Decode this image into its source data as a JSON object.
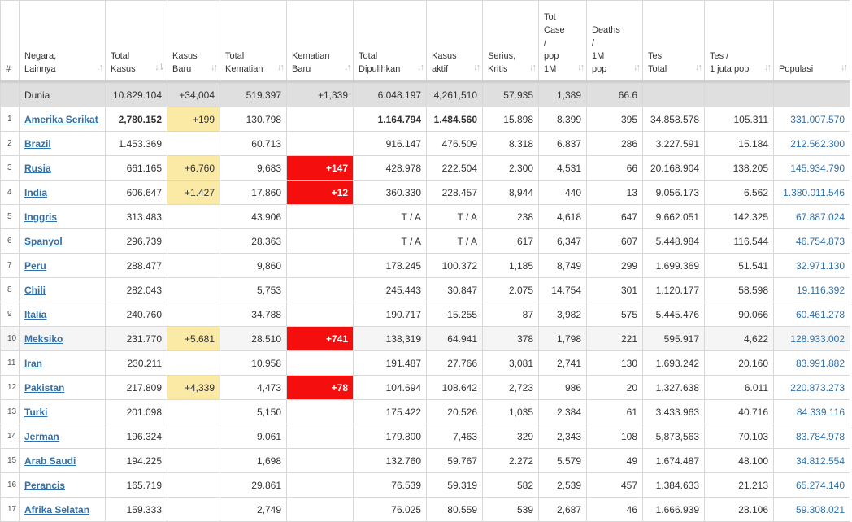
{
  "columns": [
    {
      "label": "#"
    },
    {
      "label": "Negara,\nLainnya"
    },
    {
      "label": "Total\nKasus"
    },
    {
      "label": "Kasus\nBaru"
    },
    {
      "label": "Total\nKematian"
    },
    {
      "label": "Kematian\nBaru"
    },
    {
      "label": "Total\nDipulihkan"
    },
    {
      "label": "Kasus\naktif"
    },
    {
      "label": "Serius,\nKritis"
    },
    {
      "label": "Tot\nCase\n/\npop\n1M"
    },
    {
      "label": "Deaths\n/\n1M\npop"
    },
    {
      "label": "Tes\nTotal"
    },
    {
      "label": "Tes /\n1 juta pop"
    },
    {
      "label": "Populasi"
    }
  ],
  "sort_icon": "sort-arrows-icon",
  "world": {
    "country": "Dunia",
    "total_cases": "10.829.104",
    "new_cases": "+34,004",
    "total_deaths": "519.397",
    "new_deaths": "+1,339",
    "recovered": "6.048.197",
    "active": "4,261,510",
    "serious": "57.935",
    "cases_per_1m": "1,389",
    "deaths_per_1m": "66.6",
    "tests": "",
    "tests_per_1m": "",
    "population": ""
  },
  "rows": [
    {
      "rank": "1",
      "country": "Amerika Serikat",
      "total_cases": "2,780.152",
      "new_cases": "+199",
      "total_deaths": "130.798",
      "new_deaths": "",
      "recovered": "1.164.794",
      "active": "1.484.560",
      "serious": "15.898",
      "cases_per_1m": "8.399",
      "deaths_per_1m": "395",
      "tests": "34.858.578",
      "tests_per_1m": "105.311",
      "population": "331.007.570"
    },
    {
      "rank": "2",
      "country": "Brazil",
      "total_cases": "1.453.369",
      "new_cases": "",
      "total_deaths": "60.713",
      "new_deaths": "",
      "recovered": "916.147",
      "active": "476.509",
      "serious": "8.318",
      "cases_per_1m": "6.837",
      "deaths_per_1m": "286",
      "tests": "3.227.591",
      "tests_per_1m": "15.184",
      "population": "212.562.300"
    },
    {
      "rank": "3",
      "country": "Rusia",
      "total_cases": "661.165",
      "new_cases": "+6.760",
      "total_deaths": "9,683",
      "new_deaths": "+147",
      "recovered": "428.978",
      "active": "222.504",
      "serious": "2.300",
      "cases_per_1m": "4,531",
      "deaths_per_1m": "66",
      "tests": "20.168.904",
      "tests_per_1m": "138.205",
      "population": "145.934.790"
    },
    {
      "rank": "4",
      "country": "India",
      "total_cases": "606.647",
      "new_cases": "+1.427",
      "total_deaths": "17.860",
      "new_deaths": "+12",
      "recovered": "360.330",
      "active": "228.457",
      "serious": "8,944",
      "cases_per_1m": "440",
      "deaths_per_1m": "13",
      "tests": "9.056.173",
      "tests_per_1m": "6.562",
      "population": "1.380.011.546"
    },
    {
      "rank": "5",
      "country": "Inggris",
      "total_cases": "313.483",
      "new_cases": "",
      "total_deaths": "43.906",
      "new_deaths": "",
      "recovered": "T / A",
      "active": "T / A",
      "serious": "238",
      "cases_per_1m": "4,618",
      "deaths_per_1m": "647",
      "tests": "9.662.051",
      "tests_per_1m": "142.325",
      "population": "67.887.024"
    },
    {
      "rank": "6",
      "country": "Spanyol",
      "total_cases": "296.739",
      "new_cases": "",
      "total_deaths": "28.363",
      "new_deaths": "",
      "recovered": "T / A",
      "active": "T / A",
      "serious": "617",
      "cases_per_1m": "6,347",
      "deaths_per_1m": "607",
      "tests": "5.448.984",
      "tests_per_1m": "116.544",
      "population": "46.754.873"
    },
    {
      "rank": "7",
      "country": "Peru",
      "total_cases": "288.477",
      "new_cases": "",
      "total_deaths": "9,860",
      "new_deaths": "",
      "recovered": "178.245",
      "active": "100.372",
      "serious": "1,185",
      "cases_per_1m": "8,749",
      "deaths_per_1m": "299",
      "tests": "1.699.369",
      "tests_per_1m": "51.541",
      "population": "32.971.130"
    },
    {
      "rank": "8",
      "country": "Chili",
      "total_cases": "282.043",
      "new_cases": "",
      "total_deaths": "5,753",
      "new_deaths": "",
      "recovered": "245.443",
      "active": "30.847",
      "serious": "2.075",
      "cases_per_1m": "14.754",
      "deaths_per_1m": "301",
      "tests": "1.120.177",
      "tests_per_1m": "58.598",
      "population": "19.116.392"
    },
    {
      "rank": "9",
      "country": "Italia",
      "total_cases": "240.760",
      "new_cases": "",
      "total_deaths": "34.788",
      "new_deaths": "",
      "recovered": "190.717",
      "active": "15.255",
      "serious": "87",
      "cases_per_1m": "3,982",
      "deaths_per_1m": "575",
      "tests": "5.445.476",
      "tests_per_1m": "90.066",
      "population": "60.461.278"
    },
    {
      "rank": "10",
      "country": "Meksiko",
      "total_cases": "231.770",
      "new_cases": "+5.681",
      "total_deaths": "28.510",
      "new_deaths": "+741",
      "recovered": "138,319",
      "active": "64.941",
      "serious": "378",
      "cases_per_1m": "1,798",
      "deaths_per_1m": "221",
      "tests": "595.917",
      "tests_per_1m": "4,622",
      "population": "128.933.002"
    },
    {
      "rank": "11",
      "country": "Iran",
      "total_cases": "230.211",
      "new_cases": "",
      "total_deaths": "10.958",
      "new_deaths": "",
      "recovered": "191.487",
      "active": "27.766",
      "serious": "3,081",
      "cases_per_1m": "2,741",
      "deaths_per_1m": "130",
      "tests": "1.693.242",
      "tests_per_1m": "20.160",
      "population": "83.991.882"
    },
    {
      "rank": "12",
      "country": "Pakistan",
      "total_cases": "217.809",
      "new_cases": "+4,339",
      "total_deaths": "4,473",
      "new_deaths": "+78",
      "recovered": "104.694",
      "active": "108.642",
      "serious": "2,723",
      "cases_per_1m": "986",
      "deaths_per_1m": "20",
      "tests": "1.327.638",
      "tests_per_1m": "6.011",
      "population": "220.873.273"
    },
    {
      "rank": "13",
      "country": "Turki",
      "total_cases": "201.098",
      "new_cases": "",
      "total_deaths": "5,150",
      "new_deaths": "",
      "recovered": "175.422",
      "active": "20.526",
      "serious": "1,035",
      "cases_per_1m": "2.384",
      "deaths_per_1m": "61",
      "tests": "3.433.963",
      "tests_per_1m": "40.716",
      "population": "84.339.116"
    },
    {
      "rank": "14",
      "country": "Jerman",
      "total_cases": "196.324",
      "new_cases": "",
      "total_deaths": "9.061",
      "new_deaths": "",
      "recovered": "179.800",
      "active": "7,463",
      "serious": "329",
      "cases_per_1m": "2,343",
      "deaths_per_1m": "108",
      "tests": "5,873,563",
      "tests_per_1m": "70.103",
      "population": "83.784.978"
    },
    {
      "rank": "15",
      "country": "Arab Saudi",
      "total_cases": "194.225",
      "new_cases": "",
      "total_deaths": "1,698",
      "new_deaths": "",
      "recovered": "132.760",
      "active": "59.767",
      "serious": "2.272",
      "cases_per_1m": "5.579",
      "deaths_per_1m": "49",
      "tests": "1.674.487",
      "tests_per_1m": "48.100",
      "population": "34.812.554"
    },
    {
      "rank": "16",
      "country": "Perancis",
      "total_cases": "165.719",
      "new_cases": "",
      "total_deaths": "29.861",
      "new_deaths": "",
      "recovered": "76.539",
      "active": "59.319",
      "serious": "582",
      "cases_per_1m": "2,539",
      "deaths_per_1m": "457",
      "tests": "1.384.633",
      "tests_per_1m": "21.213",
      "population": "65.274.140"
    },
    {
      "rank": "17",
      "country": "Afrika Selatan",
      "total_cases": "159.333",
      "new_cases": "",
      "total_deaths": "2,749",
      "new_deaths": "",
      "recovered": "76.025",
      "active": "80.559",
      "serious": "539",
      "cases_per_1m": "2,687",
      "deaths_per_1m": "46",
      "tests": "1.666.939",
      "tests_per_1m": "28.106",
      "population": "59.308.021"
    }
  ],
  "colors": {
    "header_border": "#cfcfcf",
    "world_row_bg": "#dfdfdf",
    "new_cases_highlight": "#fbe9a6",
    "new_deaths_highlight": "#f50e0e",
    "link": "#3170a8"
  }
}
